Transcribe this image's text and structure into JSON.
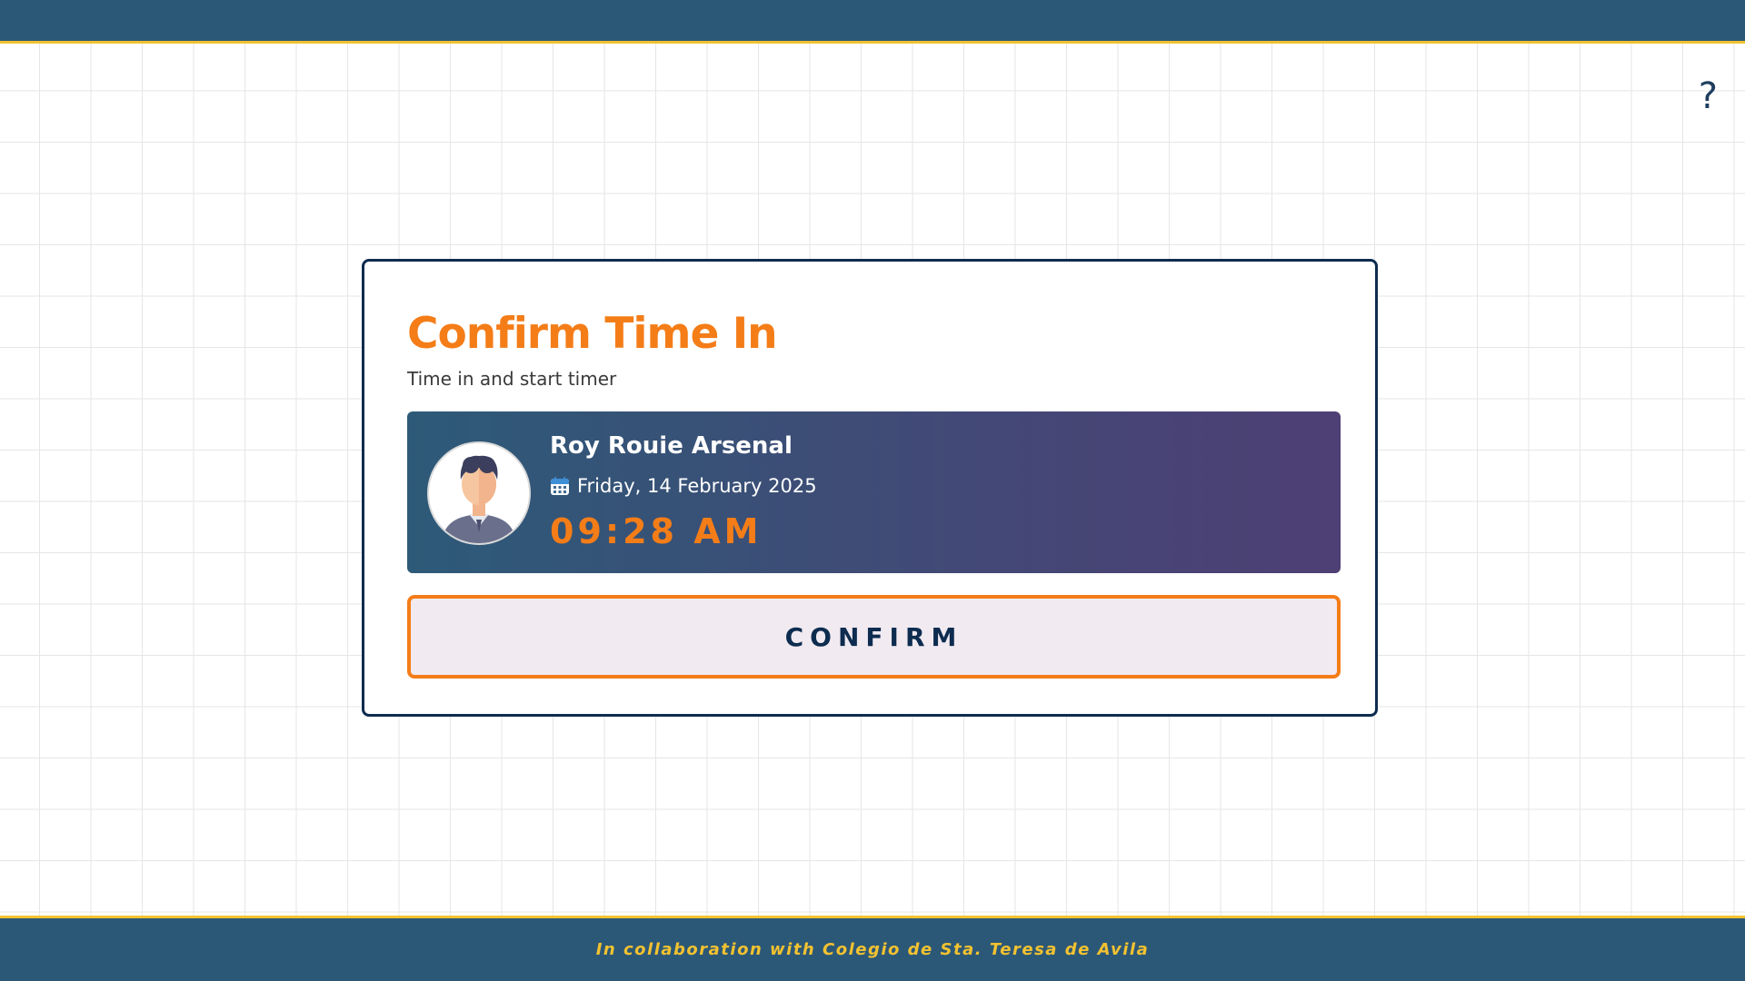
{
  "header": {
    "help_label": "?"
  },
  "card": {
    "title": "Confirm Time In",
    "subtitle": "Time in and start timer",
    "user": {
      "name": "Roy Rouie Arsenal",
      "date": "Friday, 14 February 2025",
      "time": "09:28 AM",
      "avatar_icon": "user-avatar-icon",
      "date_icon": "calendar-icon"
    },
    "confirm_label": "CONFIRM"
  },
  "footer": {
    "text": "In collaboration with Colegio de Sta. Teresa de Avila"
  },
  "colors": {
    "header_bg": "#2c5877",
    "accent_yellow": "#f2c230",
    "accent_orange": "#f47d18",
    "navy": "#0d2c4f",
    "panel_gradient_start": "#2d5a78",
    "panel_gradient_end": "#4e3f74"
  }
}
